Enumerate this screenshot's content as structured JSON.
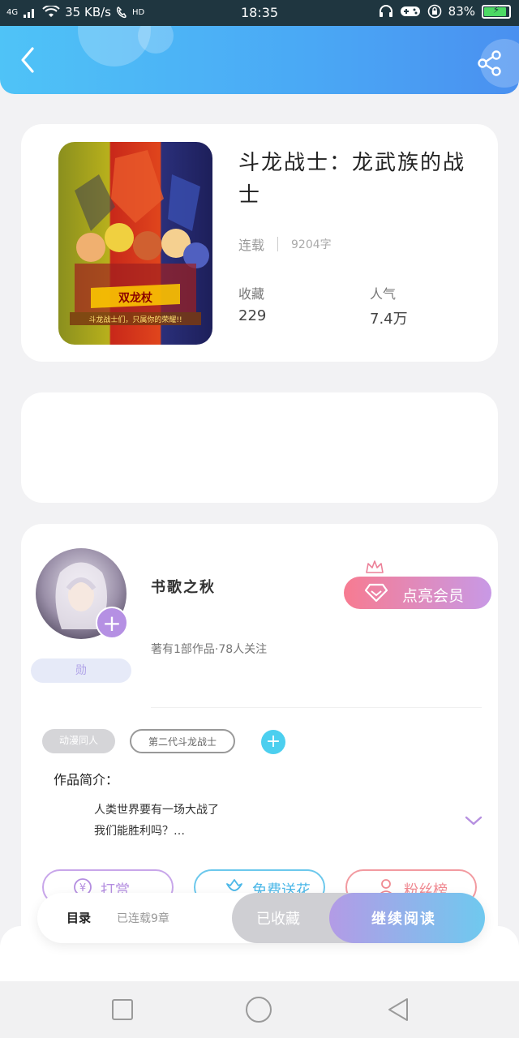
{
  "status_bar": {
    "network": "4G",
    "speed": "35 KB/s",
    "hd": "HD",
    "time": "18:35",
    "battery_percent": "83%",
    "battery_level": 0.83
  },
  "header": {
    "back_icon": "chevron-left-icon",
    "share_icon": "share-icon"
  },
  "book": {
    "title": "斗龙战士：龙武族的战士",
    "status": "连载",
    "word_count": "9204字",
    "favorites_label": "收藏",
    "favorites_value": "229",
    "popularity_label": "人气",
    "popularity_value": "7.4万",
    "cover_text": "双龙杖",
    "cover_subtext": "斗龙战士们，只属你的荣耀!!"
  },
  "author": {
    "name": "书歌之秋",
    "stats": "著有1部作品·78人关注",
    "vip_button": "点亮会员",
    "medal": "勋"
  },
  "tags": [
    "动漫同人",
    "第二代斗龙战士"
  ],
  "intro": {
    "label": "作品简介：",
    "line1": "人类世界要有一场大战了",
    "line2": "我们能胜利吗？…"
  },
  "actions": {
    "reward": "打赏",
    "flower": "免费送花",
    "fans": "粉丝榜"
  },
  "bottom_bar": {
    "catalog": "目录",
    "catalog_sub": "已连载9章",
    "collected": "已收藏",
    "continue": "继续阅读"
  },
  "colors": {
    "header_start": "#4fc3f7",
    "header_end": "#4a90f0",
    "accent_purple": "#b590e3",
    "accent_cyan": "#4ccfef",
    "vip_start": "#f77b91",
    "vip_end": "#c899e6"
  }
}
